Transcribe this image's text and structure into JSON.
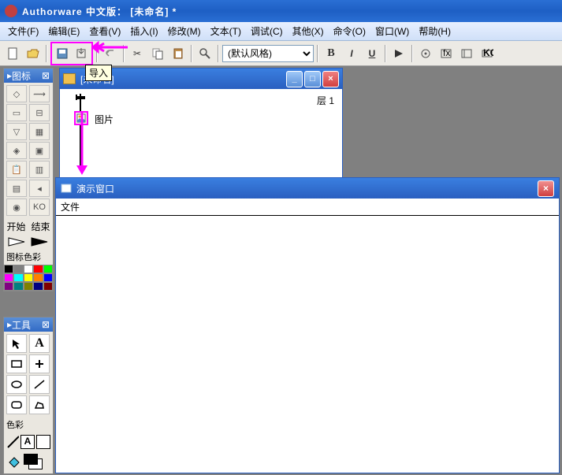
{
  "app": {
    "title": "Authorware 中文版： [未命名]  *"
  },
  "menu": {
    "file": "文件(F)",
    "edit": "编辑(E)",
    "view": "查看(V)",
    "insert": "插入(I)",
    "modify": "修改(M)",
    "text": "文本(T)",
    "debug": "调试(C)",
    "other": "其他(X)",
    "command": "命令(O)",
    "window": "窗口(W)",
    "help": "帮助(H)"
  },
  "toolbar": {
    "style_selected": "(默认风格)",
    "tooltip_import": "导入"
  },
  "panels": {
    "icons_title": "图标",
    "start": "开始",
    "end": "结束",
    "icon_color": "图标色彩",
    "tools_title": "工具",
    "color": "色彩"
  },
  "doc": {
    "title": "[未命名]",
    "layer": "层 1",
    "node_label": "图片"
  },
  "presentation": {
    "title": "演示窗口",
    "menu_file": "文件"
  },
  "colors": {
    "palette": [
      "#000000",
      "#808080",
      "#800000",
      "#808000",
      "#008000",
      "#c0c0c0",
      "#ffffff",
      "#ff0000",
      "#ffff00",
      "#00ff00",
      "#000080",
      "#800080",
      "#008080",
      "#ff00ff",
      "#00ffff",
      "#0000ff",
      "#ff8000",
      "#8000ff",
      "#80ff00",
      "#0080ff"
    ]
  }
}
